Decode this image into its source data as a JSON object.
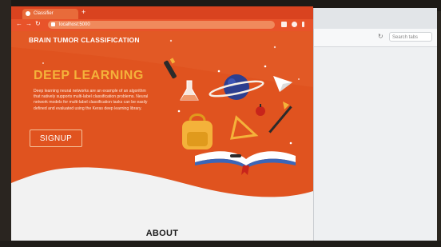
{
  "browser": {
    "tab_title": "Classifier",
    "new_tab_symbol": "+",
    "back_symbol": "←",
    "forward_symbol": "→",
    "reload_symbol": "↻",
    "address": "localhost:5000",
    "accent": "#d9431f"
  },
  "right_window": {
    "search_placeholder": "Search tabs",
    "reload_symbol": "↻"
  },
  "site": {
    "brand": "BRAIN TUMOR CLASSIFICATION",
    "headline": "DEEP LEARNING",
    "description": "Deep learning neural networks are an example of an algorithm that natively supports multi-label classification problems. Neural network models for multi-label classification tasks can be easily defined and evaluated using the Keras deep learning library.",
    "signup_label": "SIGNUP",
    "about_label": "ABOUT",
    "colors": {
      "hero_bg": "#e0531f",
      "headline": "#f4b23a",
      "wave": "#f2f2f2"
    }
  },
  "icons": [
    "globe-icon",
    "telescope-icon",
    "paper-plane-icon",
    "backpack-icon",
    "triangle-ruler-icon",
    "open-book-icon",
    "flask-icon",
    "apple-icon",
    "paintbrush-icon"
  ]
}
